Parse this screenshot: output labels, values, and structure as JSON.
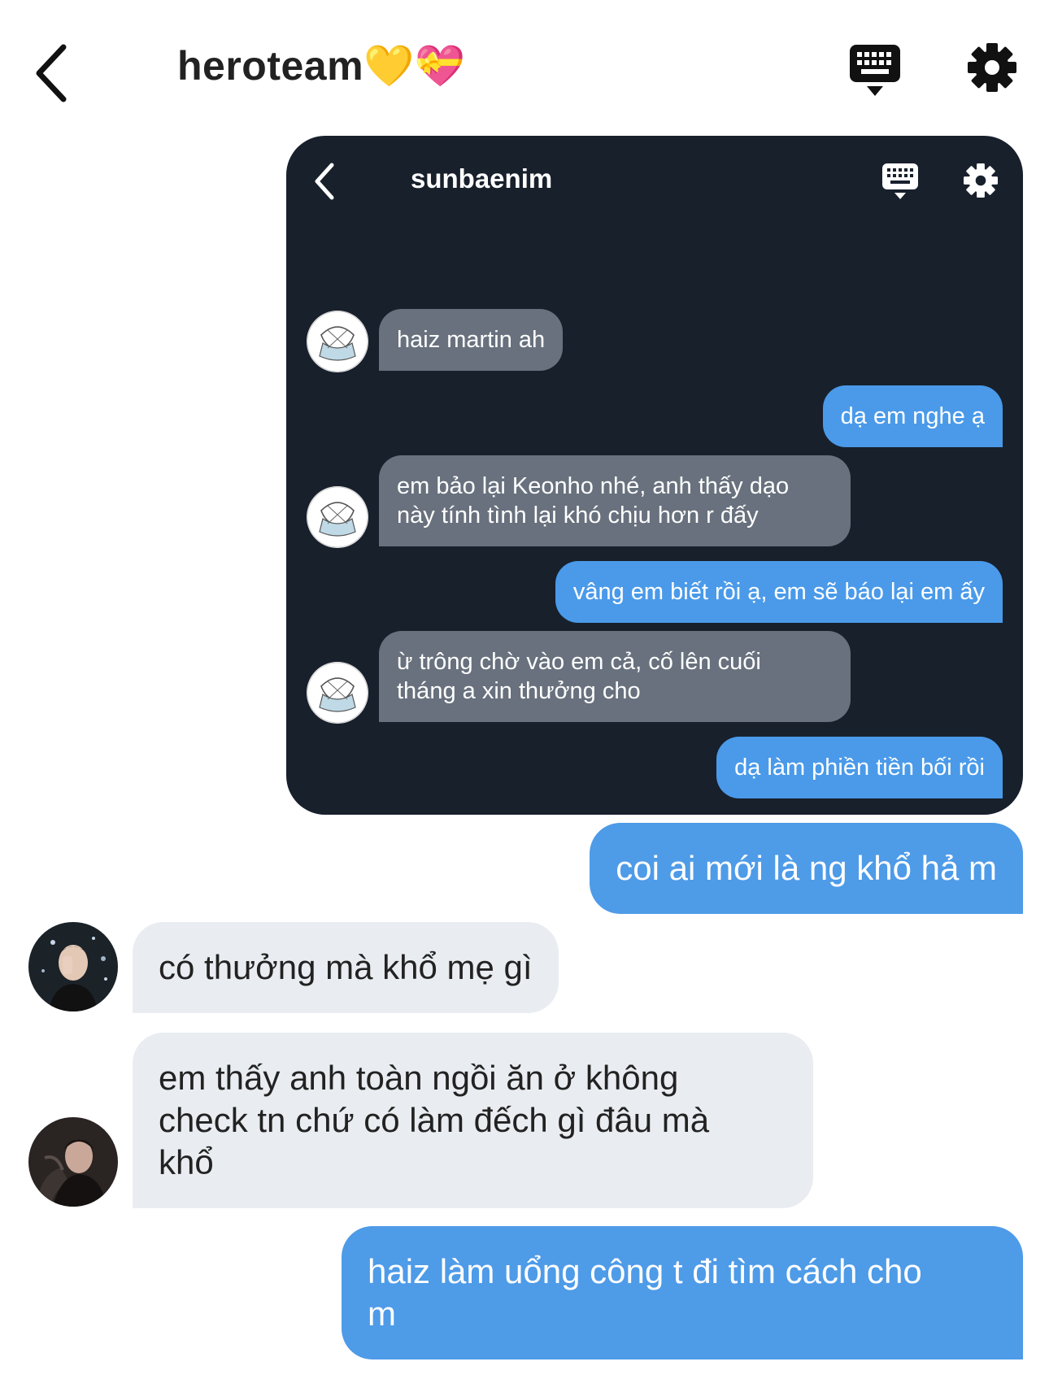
{
  "header": {
    "title": "heroteam💛💝",
    "back_icon": "chevron-left-icon",
    "keyboard_icon": "keyboard-icon",
    "settings_icon": "gear-icon"
  },
  "embedded_screenshot": {
    "title": "sunbaenim",
    "messages": [
      {
        "side": "in",
        "text": "haiz martin ah"
      },
      {
        "side": "out",
        "text": "dạ em nghe ạ"
      },
      {
        "side": "in",
        "text": "em bảo lại Keonho nhé, anh thấy dạo\nnày tính tình lại khó chịu hơn r đấy"
      },
      {
        "side": "out",
        "text": "vâng em biết rồi ạ, em sẽ báo lại em ấy"
      },
      {
        "side": "in",
        "text": "ừ trông chờ vào em cả, cố lên cuối\ntháng a xin thưởng cho"
      },
      {
        "side": "out",
        "text": "dạ làm phiền tiền bối rồi"
      }
    ]
  },
  "messages": [
    {
      "side": "out",
      "text": "coi ai mới là ng khổ hả m"
    },
    {
      "side": "in",
      "text": "có thưởng mà khổ mẹ gì"
    },
    {
      "side": "in",
      "text": "em thấy anh toàn ngồi ăn ở không\ncheck tn chứ có làm đếch gì đâu mà\nkhổ"
    },
    {
      "side": "out",
      "text": "haiz làm uổng công t đi tìm cách cho\nm"
    }
  ],
  "colors": {
    "outgoing_bubble": "#4e9be8",
    "incoming_bubble": "#e9ecf0",
    "embedded_background": "#18202c",
    "embedded_incoming": "#68717d",
    "embedded_outgoing": "#4a9ae9"
  }
}
